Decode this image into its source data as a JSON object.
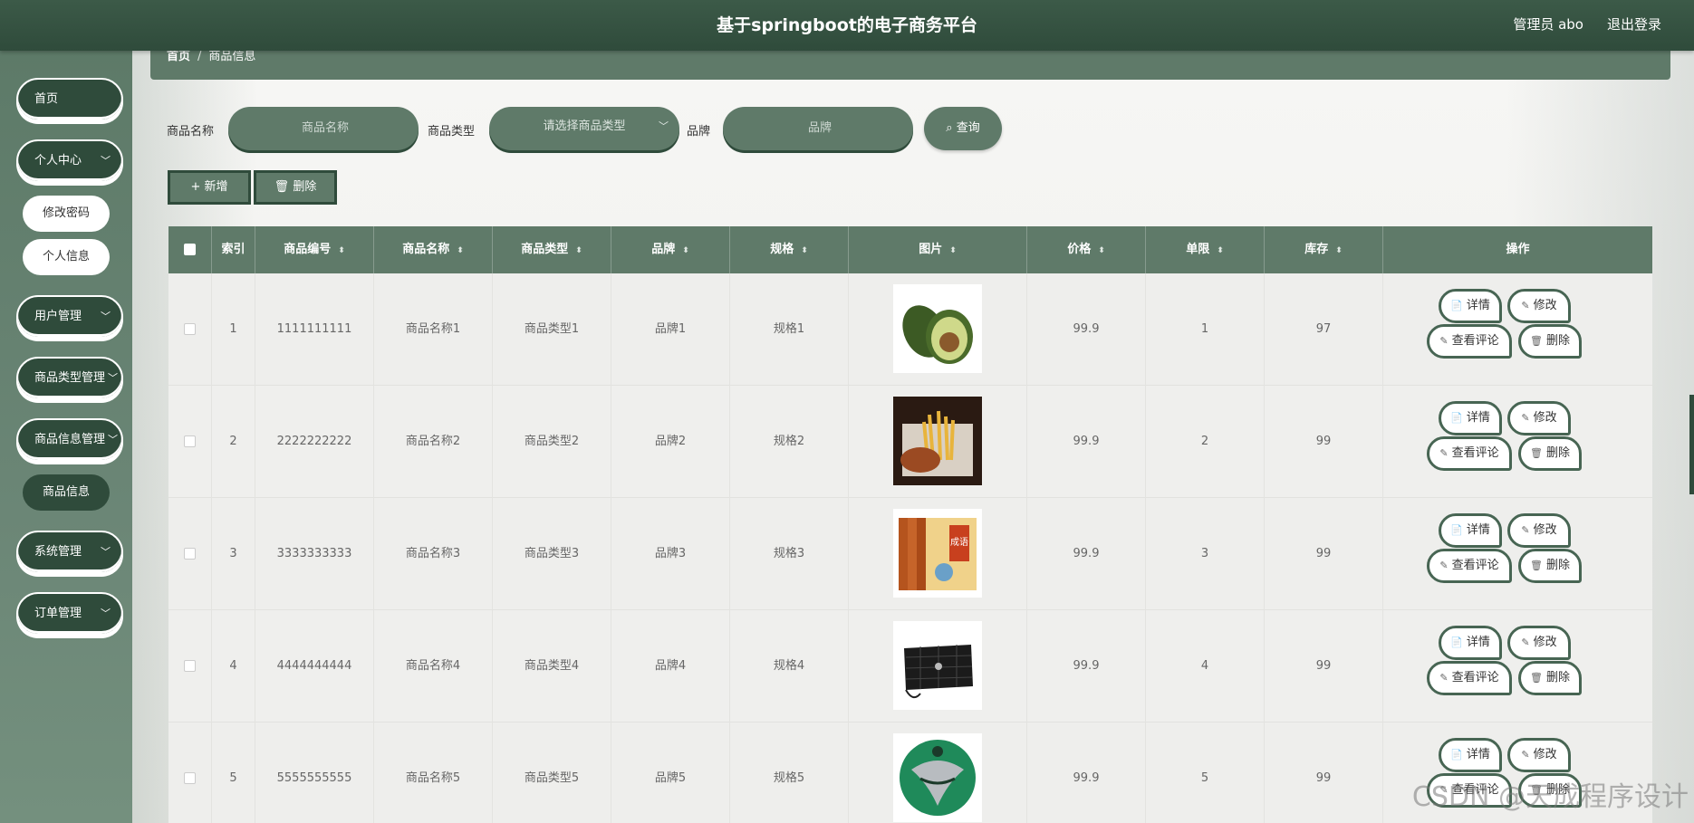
{
  "header": {
    "title": "基于springboot的电子商务平台",
    "user": "管理员 abo",
    "logout": "退出登录"
  },
  "sidebar": {
    "items": [
      {
        "label": "首页"
      },
      {
        "label": "个人中心",
        "sub": [
          "修改密码",
          "个人信息"
        ]
      },
      {
        "label": "用户管理"
      },
      {
        "label": "商品类型管理"
      },
      {
        "label": "商品信息管理",
        "sub": [
          "商品信息"
        ]
      },
      {
        "label": "系统管理"
      },
      {
        "label": "订单管理"
      }
    ]
  },
  "breadcrumb": {
    "home": "首页",
    "sep": "/",
    "current": "商品信息"
  },
  "search": {
    "name_label": "商品名称",
    "name_placeholder": "商品名称",
    "type_label": "商品类型",
    "type_placeholder": "请选择商品类型",
    "brand_label": "品牌",
    "brand_placeholder": "品牌",
    "query": "查询"
  },
  "toolbar": {
    "add": "新增",
    "delete": "删除"
  },
  "table": {
    "columns": [
      "索引",
      "商品编号",
      "商品名称",
      "商品类型",
      "品牌",
      "规格",
      "图片",
      "价格",
      "单限",
      "库存",
      "操作"
    ],
    "rows": [
      {
        "index": "1",
        "code": "1111111111",
        "name": "商品名称1",
        "type": "商品类型1",
        "brand": "品牌1",
        "spec": "规格1",
        "image": "avocado",
        "price": "99.9",
        "limit": "1",
        "stock": "97"
      },
      {
        "index": "2",
        "code": "2222222222",
        "name": "商品名称2",
        "type": "商品类型2",
        "brand": "品牌2",
        "spec": "规格2",
        "image": "burger-and-fries",
        "price": "99.9",
        "limit": "2",
        "stock": "99"
      },
      {
        "index": "3",
        "code": "3333333333",
        "name": "商品名称3",
        "type": "商品类型3",
        "brand": "品牌3",
        "spec": "规格3",
        "image": "book-set",
        "price": "99.9",
        "limit": "3",
        "stock": "99"
      },
      {
        "index": "4",
        "code": "4444444444",
        "name": "商品名称4",
        "type": "商品类型4",
        "brand": "品牌4",
        "spec": "规格4",
        "image": "black-quilted-bag",
        "price": "99.9",
        "limit": "4",
        "stock": "99"
      },
      {
        "index": "5",
        "code": "5555555555",
        "name": "商品名称5",
        "type": "商品类型5",
        "brand": "品牌5",
        "spec": "规格5",
        "image": "green-football",
        "price": "99.9",
        "limit": "5",
        "stock": "99"
      }
    ],
    "actions": {
      "detail": "详情",
      "edit": "修改",
      "comments": "查看评论",
      "delete": "删除"
    }
  },
  "watermark": "CSDN @天成程序设计",
  "colors": {
    "primary": "#5f7a69",
    "dark": "#2f4b3b"
  }
}
